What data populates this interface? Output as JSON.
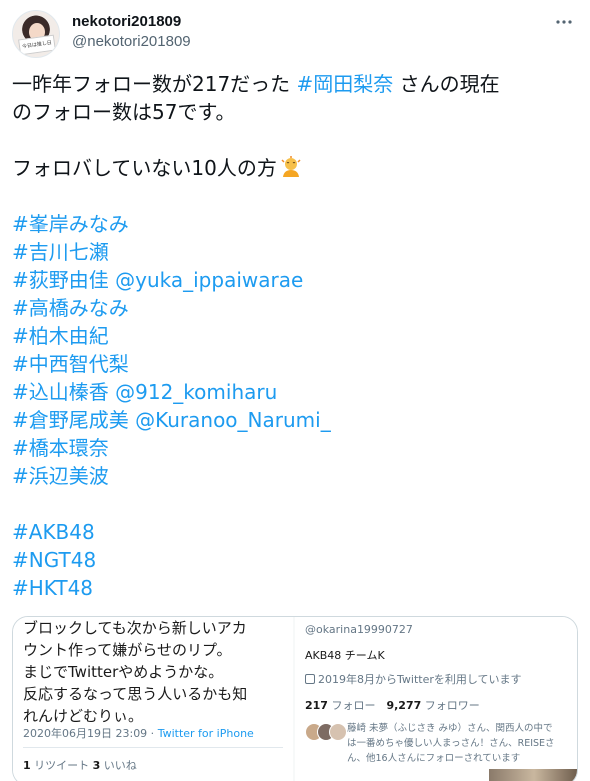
{
  "author": {
    "display_name": "nekotori201809",
    "handle": "@nekotori201809",
    "avatar_sign_text": "今日は推し日"
  },
  "more_icon": "more-horizontal-icon",
  "tweet": {
    "line1_text": "一昨年フォロー数が217だった ",
    "line1_tag": "#岡田梨奈",
    "line1_rest": " さんの現在",
    "line2": "のフォロー数は57です。",
    "line3": "フォロバしていない10人の方",
    "emoji": "person-bowing-emoji",
    "mentions": [
      {
        "tag": "#峯岸みなみ",
        "extra": ""
      },
      {
        "tag": "#吉川七瀬",
        "extra": ""
      },
      {
        "tag": "#荻野由佳",
        "extra": " @yuka_ippaiwarae"
      },
      {
        "tag": "#高橋みなみ",
        "extra": ""
      },
      {
        "tag": "#柏木由紀",
        "extra": ""
      },
      {
        "tag": "#中西智代梨",
        "extra": ""
      },
      {
        "tag": "#込山榛香",
        "extra": " @912_komiharu"
      },
      {
        "tag": "#倉野尾成美",
        "extra": " @Kuranoo_Narumi_"
      },
      {
        "tag": "#橋本環奈",
        "extra": ""
      },
      {
        "tag": "#浜辺美波",
        "extra": ""
      }
    ],
    "group_tags": [
      "#AKB48",
      "#NGT48",
      "#HKT48"
    ]
  },
  "media": {
    "left": {
      "text_lines": [
        "ブロックしても次から新しいアカ",
        "ウント作って嫌がらせのリプ。",
        "まじでTwitterやめようかな。",
        "反応するなって思う人いるかも知",
        "れんけどむりぃ。"
      ],
      "timestamp": "2020年06月19日 23:09 · ",
      "via": "Twitter for iPhone",
      "retweets_count": "1",
      "retweets_label": " リツイート ",
      "likes_count": "3",
      "likes_label": " いいね"
    },
    "right": {
      "handle": "@okarina19990727",
      "bio": "AKB48 チームK",
      "joined": "2019年8月からTwitterを利用しています",
      "following_count": "217",
      "following_label": " フォロー　",
      "followers_count": "9,277",
      "followers_label": " フォロワー",
      "followed_by_line1": "藤崎 未夢（ふじさき みゆ）さん、関西人の中で",
      "followed_by_line2": "は一番めちゃ優しい人まっさん！さん、REISEさ",
      "followed_by_line3": "ん、他16人さんにフォローされています"
    }
  },
  "colors": {
    "link": "#1d9bf0",
    "text": "#0f1419",
    "muted": "#536471",
    "border": "#cfd9de"
  }
}
